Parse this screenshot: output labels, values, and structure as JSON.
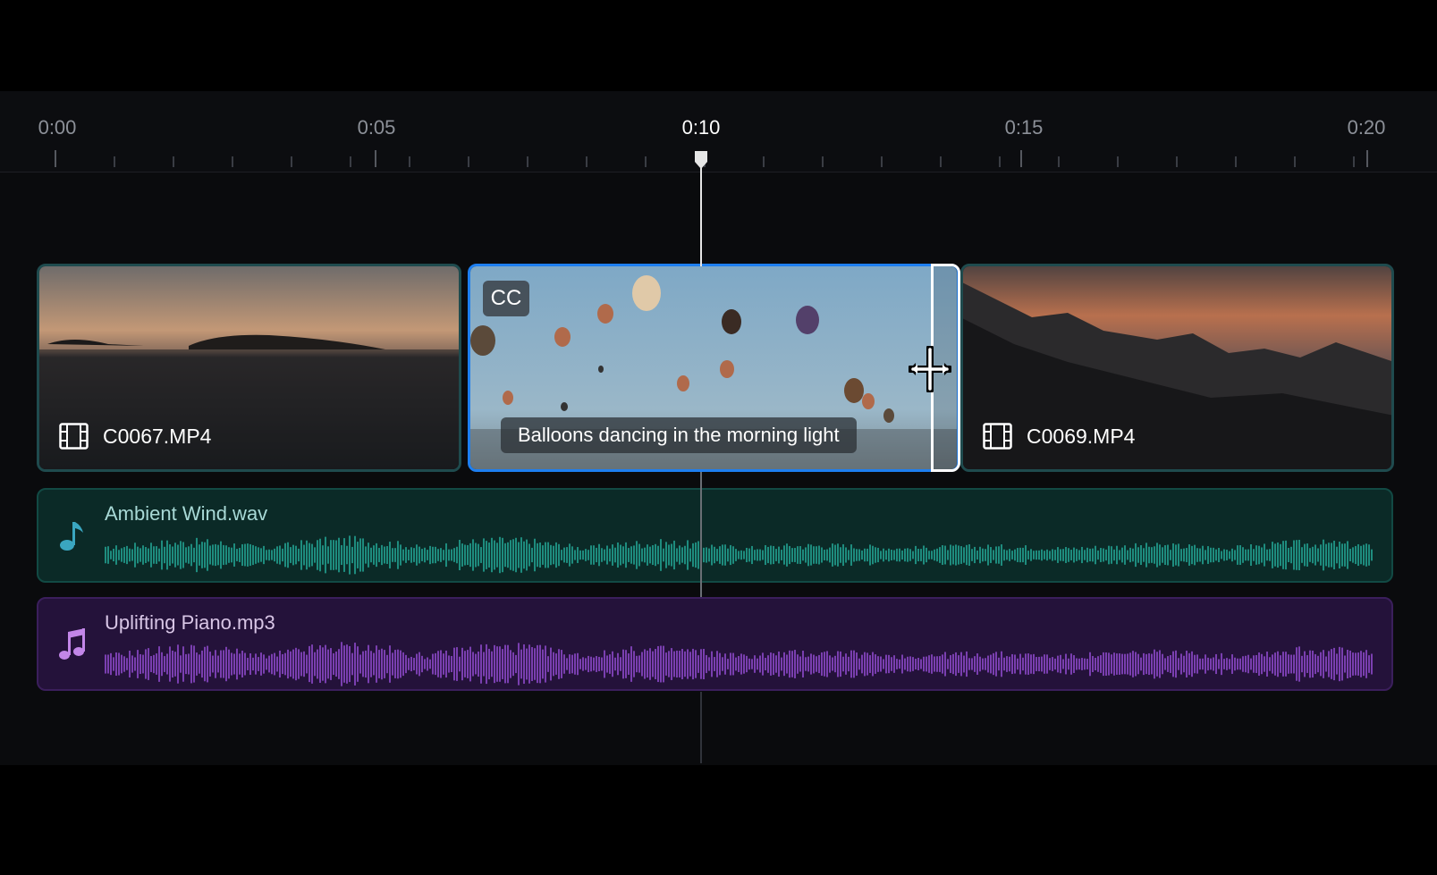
{
  "ruler": {
    "labels": [
      {
        "text": "0:00",
        "active": false
      },
      {
        "text": "0:05",
        "active": false
      },
      {
        "text": "0:10",
        "active": true
      },
      {
        "text": "0:15",
        "active": false
      },
      {
        "text": "0:20",
        "active": false
      }
    ],
    "playhead_time": "0:10"
  },
  "tracks": {
    "video": {
      "clip1": {
        "label": "C0067.MP4",
        "icon": "film-icon"
      },
      "clip2": {
        "cc_label": "CC",
        "caption": "Balloons dancing in the morning light",
        "selected": true
      },
      "clip3": {
        "label": "C0069.MP4",
        "icon": "film-icon"
      }
    },
    "audio": [
      {
        "name": "Ambient Wind.wav",
        "icon": "music-note-icon",
        "color": "#1e8c7e"
      },
      {
        "name": "Uplifting Piano.mp3",
        "icon": "music-notes-icon",
        "color": "#7a3fb0"
      }
    ]
  },
  "colors": {
    "selection": "#1e7ff0",
    "playhead": "#e6e6e6",
    "wind_wave": "#1e8c7e",
    "piano_wave": "#7a3fb0"
  }
}
